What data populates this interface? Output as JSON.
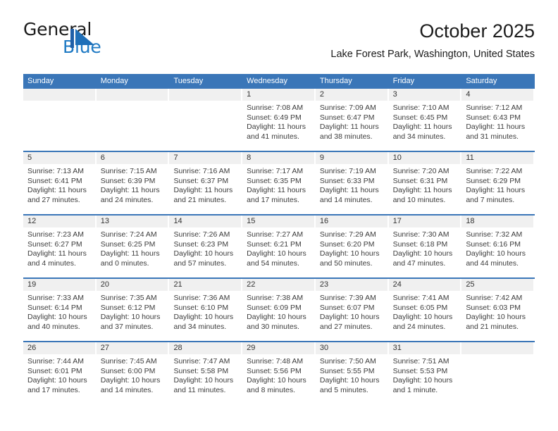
{
  "brand": {
    "name_part1": "General",
    "name_part2": "Blue",
    "logo_icon": "triangle-logo-icon",
    "accent_color": "#1f7ac4"
  },
  "header": {
    "title": "October 2025",
    "subtitle": "Lake Forest Park, Washington, United States"
  },
  "calendar": {
    "header_bg": "#3a76b8",
    "daynum_bg": "#f0f0f0",
    "weekday_headers": [
      "Sunday",
      "Monday",
      "Tuesday",
      "Wednesday",
      "Thursday",
      "Friday",
      "Saturday"
    ],
    "weeks": [
      [
        {
          "day": "",
          "sunrise": "",
          "sunset": "",
          "daylight": ""
        },
        {
          "day": "",
          "sunrise": "",
          "sunset": "",
          "daylight": ""
        },
        {
          "day": "",
          "sunrise": "",
          "sunset": "",
          "daylight": ""
        },
        {
          "day": "1",
          "sunrise": "Sunrise: 7:08 AM",
          "sunset": "Sunset: 6:49 PM",
          "daylight": "Daylight: 11 hours and 41 minutes."
        },
        {
          "day": "2",
          "sunrise": "Sunrise: 7:09 AM",
          "sunset": "Sunset: 6:47 PM",
          "daylight": "Daylight: 11 hours and 38 minutes."
        },
        {
          "day": "3",
          "sunrise": "Sunrise: 7:10 AM",
          "sunset": "Sunset: 6:45 PM",
          "daylight": "Daylight: 11 hours and 34 minutes."
        },
        {
          "day": "4",
          "sunrise": "Sunrise: 7:12 AM",
          "sunset": "Sunset: 6:43 PM",
          "daylight": "Daylight: 11 hours and 31 minutes."
        }
      ],
      [
        {
          "day": "5",
          "sunrise": "Sunrise: 7:13 AM",
          "sunset": "Sunset: 6:41 PM",
          "daylight": "Daylight: 11 hours and 27 minutes."
        },
        {
          "day": "6",
          "sunrise": "Sunrise: 7:15 AM",
          "sunset": "Sunset: 6:39 PM",
          "daylight": "Daylight: 11 hours and 24 minutes."
        },
        {
          "day": "7",
          "sunrise": "Sunrise: 7:16 AM",
          "sunset": "Sunset: 6:37 PM",
          "daylight": "Daylight: 11 hours and 21 minutes."
        },
        {
          "day": "8",
          "sunrise": "Sunrise: 7:17 AM",
          "sunset": "Sunset: 6:35 PM",
          "daylight": "Daylight: 11 hours and 17 minutes."
        },
        {
          "day": "9",
          "sunrise": "Sunrise: 7:19 AM",
          "sunset": "Sunset: 6:33 PM",
          "daylight": "Daylight: 11 hours and 14 minutes."
        },
        {
          "day": "10",
          "sunrise": "Sunrise: 7:20 AM",
          "sunset": "Sunset: 6:31 PM",
          "daylight": "Daylight: 11 hours and 10 minutes."
        },
        {
          "day": "11",
          "sunrise": "Sunrise: 7:22 AM",
          "sunset": "Sunset: 6:29 PM",
          "daylight": "Daylight: 11 hours and 7 minutes."
        }
      ],
      [
        {
          "day": "12",
          "sunrise": "Sunrise: 7:23 AM",
          "sunset": "Sunset: 6:27 PM",
          "daylight": "Daylight: 11 hours and 4 minutes."
        },
        {
          "day": "13",
          "sunrise": "Sunrise: 7:24 AM",
          "sunset": "Sunset: 6:25 PM",
          "daylight": "Daylight: 11 hours and 0 minutes."
        },
        {
          "day": "14",
          "sunrise": "Sunrise: 7:26 AM",
          "sunset": "Sunset: 6:23 PM",
          "daylight": "Daylight: 10 hours and 57 minutes."
        },
        {
          "day": "15",
          "sunrise": "Sunrise: 7:27 AM",
          "sunset": "Sunset: 6:21 PM",
          "daylight": "Daylight: 10 hours and 54 minutes."
        },
        {
          "day": "16",
          "sunrise": "Sunrise: 7:29 AM",
          "sunset": "Sunset: 6:20 PM",
          "daylight": "Daylight: 10 hours and 50 minutes."
        },
        {
          "day": "17",
          "sunrise": "Sunrise: 7:30 AM",
          "sunset": "Sunset: 6:18 PM",
          "daylight": "Daylight: 10 hours and 47 minutes."
        },
        {
          "day": "18",
          "sunrise": "Sunrise: 7:32 AM",
          "sunset": "Sunset: 6:16 PM",
          "daylight": "Daylight: 10 hours and 44 minutes."
        }
      ],
      [
        {
          "day": "19",
          "sunrise": "Sunrise: 7:33 AM",
          "sunset": "Sunset: 6:14 PM",
          "daylight": "Daylight: 10 hours and 40 minutes."
        },
        {
          "day": "20",
          "sunrise": "Sunrise: 7:35 AM",
          "sunset": "Sunset: 6:12 PM",
          "daylight": "Daylight: 10 hours and 37 minutes."
        },
        {
          "day": "21",
          "sunrise": "Sunrise: 7:36 AM",
          "sunset": "Sunset: 6:10 PM",
          "daylight": "Daylight: 10 hours and 34 minutes."
        },
        {
          "day": "22",
          "sunrise": "Sunrise: 7:38 AM",
          "sunset": "Sunset: 6:09 PM",
          "daylight": "Daylight: 10 hours and 30 minutes."
        },
        {
          "day": "23",
          "sunrise": "Sunrise: 7:39 AM",
          "sunset": "Sunset: 6:07 PM",
          "daylight": "Daylight: 10 hours and 27 minutes."
        },
        {
          "day": "24",
          "sunrise": "Sunrise: 7:41 AM",
          "sunset": "Sunset: 6:05 PM",
          "daylight": "Daylight: 10 hours and 24 minutes."
        },
        {
          "day": "25",
          "sunrise": "Sunrise: 7:42 AM",
          "sunset": "Sunset: 6:03 PM",
          "daylight": "Daylight: 10 hours and 21 minutes."
        }
      ],
      [
        {
          "day": "26",
          "sunrise": "Sunrise: 7:44 AM",
          "sunset": "Sunset: 6:01 PM",
          "daylight": "Daylight: 10 hours and 17 minutes."
        },
        {
          "day": "27",
          "sunrise": "Sunrise: 7:45 AM",
          "sunset": "Sunset: 6:00 PM",
          "daylight": "Daylight: 10 hours and 14 minutes."
        },
        {
          "day": "28",
          "sunrise": "Sunrise: 7:47 AM",
          "sunset": "Sunset: 5:58 PM",
          "daylight": "Daylight: 10 hours and 11 minutes."
        },
        {
          "day": "29",
          "sunrise": "Sunrise: 7:48 AM",
          "sunset": "Sunset: 5:56 PM",
          "daylight": "Daylight: 10 hours and 8 minutes."
        },
        {
          "day": "30",
          "sunrise": "Sunrise: 7:50 AM",
          "sunset": "Sunset: 5:55 PM",
          "daylight": "Daylight: 10 hours and 5 minutes."
        },
        {
          "day": "31",
          "sunrise": "Sunrise: 7:51 AM",
          "sunset": "Sunset: 5:53 PM",
          "daylight": "Daylight: 10 hours and 1 minute."
        },
        {
          "day": "",
          "sunrise": "",
          "sunset": "",
          "daylight": ""
        }
      ]
    ]
  }
}
